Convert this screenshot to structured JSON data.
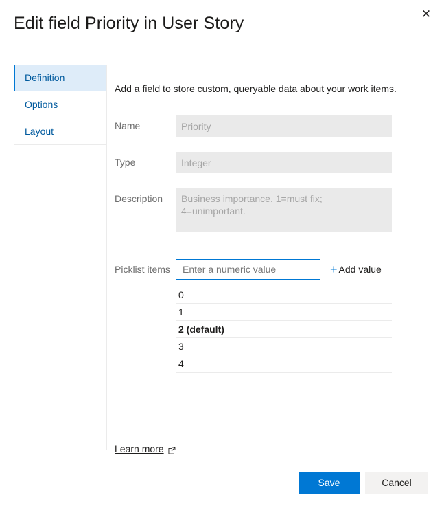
{
  "dialog": {
    "title": "Edit field Priority in User Story",
    "close_label": "✕"
  },
  "tabs": [
    {
      "label": "Definition",
      "selected": true
    },
    {
      "label": "Options",
      "selected": false
    },
    {
      "label": "Layout",
      "selected": false
    }
  ],
  "definition": {
    "intro": "Add a field to store custom, queryable data about your work items.",
    "fields": [
      {
        "label": "Name",
        "value": "Priority",
        "disabled": true
      },
      {
        "label": "Type",
        "value": "Integer",
        "disabled": true
      },
      {
        "label": "Description",
        "value": "Business importance. 1=must fix; 4=unimportant.",
        "disabled": true
      }
    ],
    "picklist": {
      "label": "Picklist items",
      "input_placeholder": "Enter a numeric value",
      "input_value": "",
      "add_value_label": "Add value",
      "plus_icon": "+",
      "items": [
        {
          "text": "0",
          "is_default": false
        },
        {
          "text": "1",
          "is_default": false
        },
        {
          "text": "2 (default)",
          "is_default": true
        },
        {
          "text": "3",
          "is_default": false
        },
        {
          "text": "4",
          "is_default": false
        }
      ]
    },
    "learn_more": "Learn more"
  },
  "footer": {
    "save_label": "Save",
    "cancel_label": "Cancel"
  },
  "colors": {
    "accent": "#0078d4",
    "tab_selected_bg": "#deecf9",
    "tab_text": "#005a9e",
    "disabled_field_bg": "#eaeaea",
    "label_text": "#6e6e6e",
    "cancel_bg": "#f3f2f1"
  }
}
